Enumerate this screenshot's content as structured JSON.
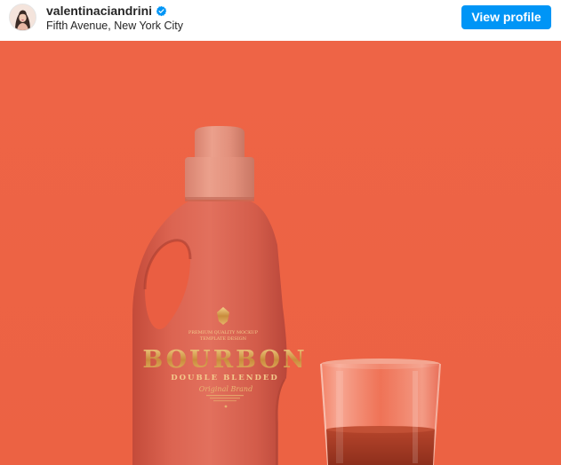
{
  "header": {
    "username": "valentinaciandrini",
    "location": "Fifth Avenue, New York City",
    "view_profile_label": "View profile"
  },
  "media": {
    "background_color": "#ee6647",
    "bottle_label": {
      "tagline_line1": "PREMIUM QUALITY MOCKUP",
      "tagline_line2": "TEMPLATE DESIGN",
      "brand": "BOURBON",
      "subtitle": "DOUBLE BLENDED",
      "script": "Original Brand"
    }
  },
  "icons": {
    "verified": "verified-badge-icon",
    "avatar": "profile-avatar"
  },
  "colors": {
    "button": "#0095f6",
    "text": "#262626",
    "label_gold": "#d9a24f"
  }
}
